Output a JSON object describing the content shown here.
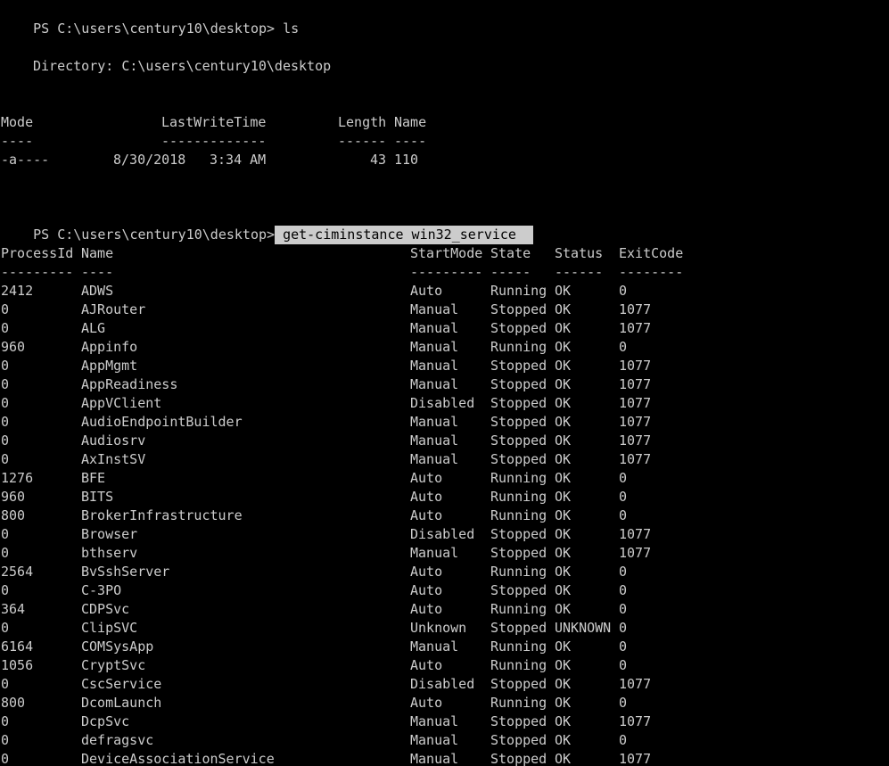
{
  "prompt": "PS C:\\users\\century10\\desktop>",
  "commands": {
    "first": "ls",
    "second": "get-ciminstance win32_service"
  },
  "directory_line": "Directory: C:\\users\\century10\\desktop",
  "ls_table": {
    "headers": {
      "mode": "Mode",
      "lastwrite": "LastWriteTime",
      "length": "Length",
      "name": "Name"
    },
    "separators": {
      "mode": "----",
      "lastwrite": "-------------",
      "length": "------",
      "name": "----"
    },
    "row": {
      "mode": "-a----",
      "date": "8/30/2018",
      "time": "3:34 AM",
      "length": "43",
      "name": "110"
    }
  },
  "service_table": {
    "headers": {
      "pid": "ProcessId",
      "name": "Name",
      "startmode": "StartMode",
      "state": "State",
      "status": "Status",
      "exitcode": "ExitCode"
    },
    "separators": {
      "pid": "---------",
      "name": "----",
      "startmode": "---------",
      "state": "-----",
      "status": "------",
      "exitcode": "--------"
    },
    "rows": [
      [
        "2412",
        "ADWS",
        "Auto",
        "Running",
        "OK",
        "0"
      ],
      [
        "0",
        "AJRouter",
        "Manual",
        "Stopped",
        "OK",
        "1077"
      ],
      [
        "0",
        "ALG",
        "Manual",
        "Stopped",
        "OK",
        "1077"
      ],
      [
        "960",
        "Appinfo",
        "Manual",
        "Running",
        "OK",
        "0"
      ],
      [
        "0",
        "AppMgmt",
        "Manual",
        "Stopped",
        "OK",
        "1077"
      ],
      [
        "0",
        "AppReadiness",
        "Manual",
        "Stopped",
        "OK",
        "1077"
      ],
      [
        "0",
        "AppVClient",
        "Disabled",
        "Stopped",
        "OK",
        "1077"
      ],
      [
        "0",
        "AudioEndpointBuilder",
        "Manual",
        "Stopped",
        "OK",
        "1077"
      ],
      [
        "0",
        "Audiosrv",
        "Manual",
        "Stopped",
        "OK",
        "1077"
      ],
      [
        "0",
        "AxInstSV",
        "Manual",
        "Stopped",
        "OK",
        "1077"
      ],
      [
        "1276",
        "BFE",
        "Auto",
        "Running",
        "OK",
        "0"
      ],
      [
        "960",
        "BITS",
        "Auto",
        "Running",
        "OK",
        "0"
      ],
      [
        "800",
        "BrokerInfrastructure",
        "Auto",
        "Running",
        "OK",
        "0"
      ],
      [
        "0",
        "Browser",
        "Disabled",
        "Stopped",
        "OK",
        "1077"
      ],
      [
        "0",
        "bthserv",
        "Manual",
        "Stopped",
        "OK",
        "1077"
      ],
      [
        "2564",
        "BvSshServer",
        "Auto",
        "Running",
        "OK",
        "0"
      ],
      [
        "0",
        "C-3PO",
        "Auto",
        "Stopped",
        "OK",
        "0"
      ],
      [
        "364",
        "CDPSvc",
        "Auto",
        "Running",
        "OK",
        "0"
      ],
      [
        "0",
        "ClipSVC",
        "Unknown",
        "Stopped",
        "UNKNOWN",
        "0"
      ],
      [
        "6164",
        "COMSysApp",
        "Manual",
        "Running",
        "OK",
        "0"
      ],
      [
        "1056",
        "CryptSvc",
        "Auto",
        "Running",
        "OK",
        "0"
      ],
      [
        "0",
        "CscService",
        "Disabled",
        "Stopped",
        "OK",
        "1077"
      ],
      [
        "800",
        "DcomLaunch",
        "Auto",
        "Running",
        "OK",
        "0"
      ],
      [
        "0",
        "DcpSvc",
        "Manual",
        "Stopped",
        "OK",
        "1077"
      ],
      [
        "0",
        "defragsvc",
        "Manual",
        "Stopped",
        "OK",
        "0"
      ],
      [
        "0",
        "DeviceAssociationService",
        "Manual",
        "Stopped",
        "OK",
        "1077"
      ]
    ]
  },
  "colors": {
    "background": "#000000",
    "text": "#cccccc",
    "selection_bg": "#cccccc",
    "selection_fg": "#000000"
  }
}
